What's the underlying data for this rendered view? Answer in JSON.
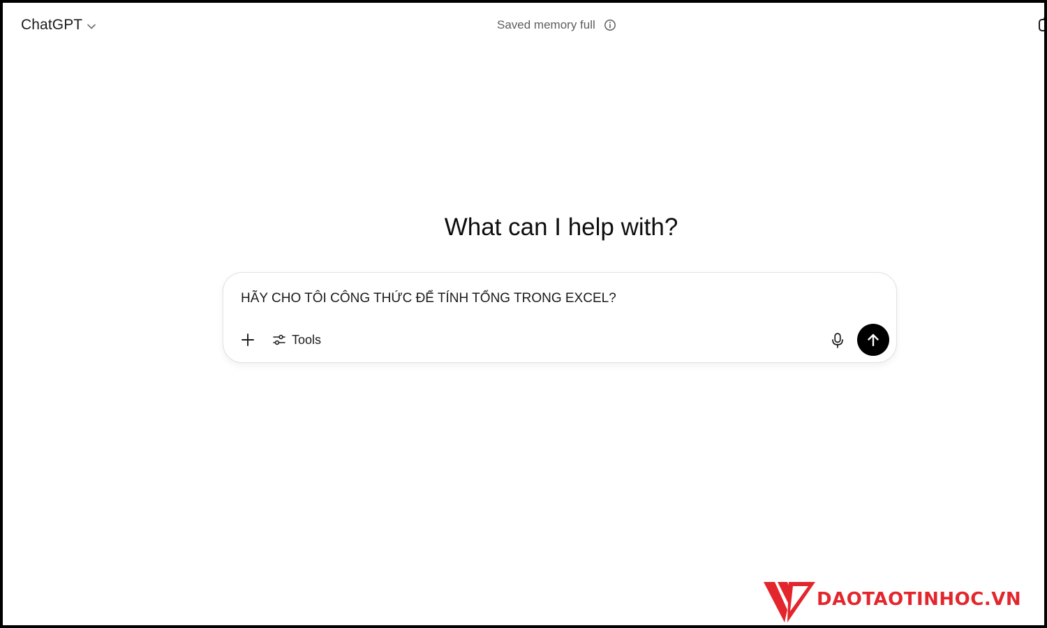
{
  "header": {
    "model_name": "ChatGPT",
    "model_switcher_icon": "chevron-down-icon",
    "memory_status": "Saved memory full",
    "memory_info_icon": "info-icon"
  },
  "main": {
    "hero_title": "What can I help with?"
  },
  "composer": {
    "input_value": "HÃY CHO TÔI CÔNG THỨC ĐỂ TÍNH TỔNG TRONG EXCEL?",
    "add_icon": "plus-icon",
    "tools_icon": "sliders-icon",
    "tools_label": "Tools",
    "mic_icon": "microphone-icon",
    "send_icon": "arrow-up-icon"
  },
  "watermark": {
    "text": "DAOTAOTINHOC.VN",
    "logo_icon": "v-logo-icon"
  },
  "colors": {
    "background": "#ffffff",
    "text_primary": "#0d0d0d",
    "text_secondary": "#5d5d5d",
    "send_button": "#000000",
    "watermark": "#e3262d",
    "frame_border": "#000000"
  }
}
